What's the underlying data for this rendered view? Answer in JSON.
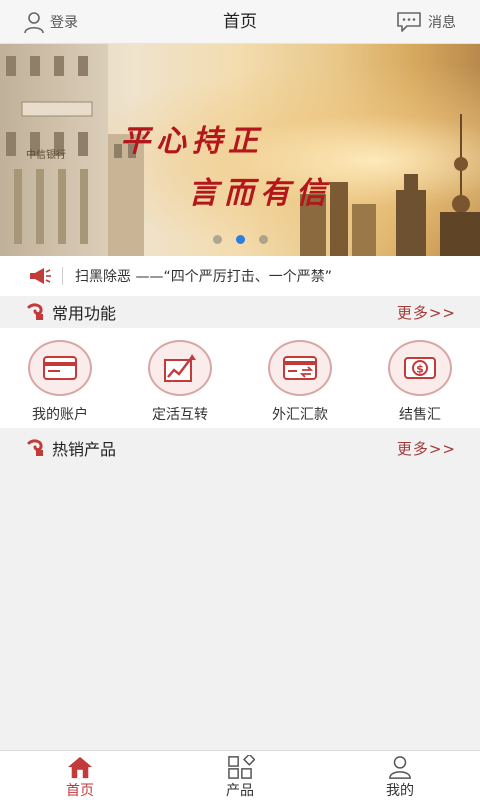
{
  "header": {
    "login_label": "登录",
    "title": "首页",
    "message_label": "消息"
  },
  "banner": {
    "bank_sign": "中信银行",
    "slogan_line1": "平心持正",
    "slogan_line2": "言而有信",
    "slide_count": 3,
    "active_slide": 2
  },
  "notice": {
    "text": "扫黑除恶 ——“四个严厉打击、一个严禁”"
  },
  "common_functions": {
    "title": "常用功能",
    "more_label": "更多>>",
    "items": [
      {
        "label": "我的账户",
        "icon": "card-icon"
      },
      {
        "label": "定活互转",
        "icon": "chart-arrow-icon"
      },
      {
        "label": "外汇汇款",
        "icon": "exchange-card-icon"
      },
      {
        "label": "结售汇",
        "icon": "dollar-cycle-icon"
      }
    ]
  },
  "hot_products": {
    "title": "热销产品",
    "more_label": "更多>>"
  },
  "tabbar": {
    "items": [
      {
        "label": "首页",
        "icon": "home-icon",
        "active": true
      },
      {
        "label": "产品",
        "icon": "grid-icon",
        "active": false
      },
      {
        "label": "我的",
        "icon": "user-icon",
        "active": false
      }
    ]
  },
  "colors": {
    "accent_red": "#c23a3a",
    "active_dot": "#2b7de0",
    "background": "#f1f1f1"
  }
}
